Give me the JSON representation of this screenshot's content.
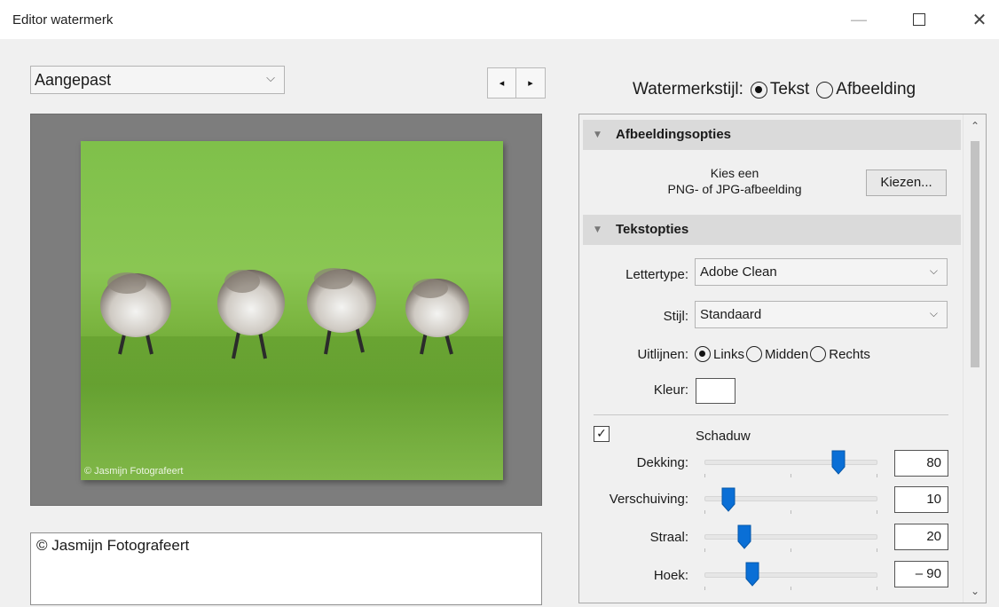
{
  "window": {
    "title": "Editor watermerk",
    "minimize": "—",
    "close": "✕"
  },
  "preset": {
    "value": "Aangepast",
    "chevron": "⌵"
  },
  "nav": {
    "prev": "◂",
    "next": "▸"
  },
  "watermark_style": {
    "label": "Watermerkstijl:",
    "options": [
      "Tekst",
      "Afbeelding"
    ],
    "selected": "Tekst"
  },
  "preview": {
    "watermark_text": "© Jasmijn Fotografeert"
  },
  "text_input": {
    "value": "© Jasmijn Fotografeert"
  },
  "image_options": {
    "header": "Afbeeldingsopties",
    "choose_line1": "Kies een",
    "choose_line2": "PNG- of JPG-afbeelding",
    "choose_button": "Kiezen..."
  },
  "text_options": {
    "header": "Tekstopties",
    "font_label": "Lettertype:",
    "font_value": "Adobe Clean",
    "style_label": "Stijl:",
    "style_value": "Standaard",
    "align_label": "Uitlijnen:",
    "align_options": [
      "Links",
      "Midden",
      "Rechts"
    ],
    "align_selected": "Links",
    "color_label": "Kleur:",
    "color_value": "#ffffff"
  },
  "shadow": {
    "label": "Schaduw",
    "enabled": true,
    "check_mark": "✓",
    "opacity": {
      "label": "Dekking:",
      "value": "80"
    },
    "offset": {
      "label": "Verschuiving:",
      "value": "10"
    },
    "radius": {
      "label": "Straal:",
      "value": "20"
    },
    "angle": {
      "label": "Hoek:",
      "value": "– 90"
    }
  },
  "scroll": {
    "up": "⌃",
    "down": "⌄"
  },
  "colors": {
    "accent": "#0a6fd6",
    "section_header": "#dadada",
    "background": "#f0f0f0"
  }
}
